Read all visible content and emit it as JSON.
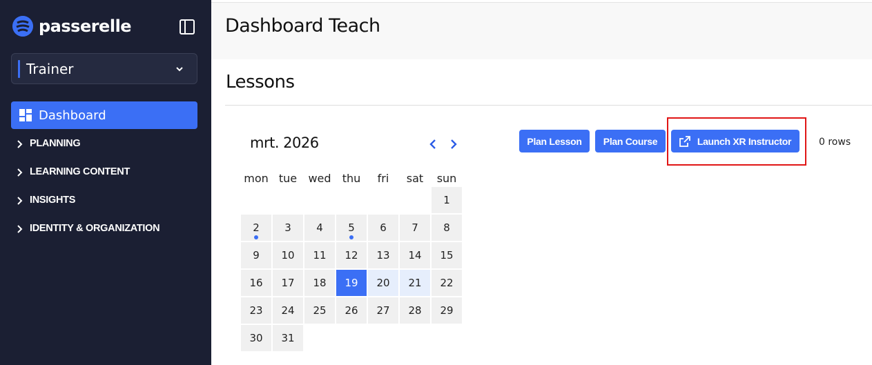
{
  "app": {
    "logo_text": "passerelle"
  },
  "sidebar": {
    "role": "Trainer",
    "dashboard_label": "Dashboard",
    "sections": [
      {
        "label": "PLANNING"
      },
      {
        "label": "LEARNING CONTENT"
      },
      {
        "label": "INSIGHTS"
      },
      {
        "label": "IDENTITY & ORGANIZATION"
      }
    ]
  },
  "header": {
    "title": "Dashboard Teach"
  },
  "lessons": {
    "title": "Lessons",
    "rows_count": "0 rows",
    "buttons": {
      "plan_lesson": "Plan Lesson",
      "plan_course": "Plan Course",
      "launch_xr": "Launch XR Instructor"
    }
  },
  "calendar": {
    "month_label": "mrt. 2026",
    "weekdays": [
      "mon",
      "tue",
      "wed",
      "thu",
      "fri",
      "sat",
      "sun"
    ],
    "first_weekday_index": 6,
    "days_in_month": 31,
    "today": 19,
    "week_highlight": [
      20,
      21
    ],
    "days_with_events": [
      2,
      5
    ]
  },
  "colors": {
    "accent": "#3b6ff5",
    "sidebar_bg": "#1b1f33",
    "highlight_border": "#e01414"
  }
}
